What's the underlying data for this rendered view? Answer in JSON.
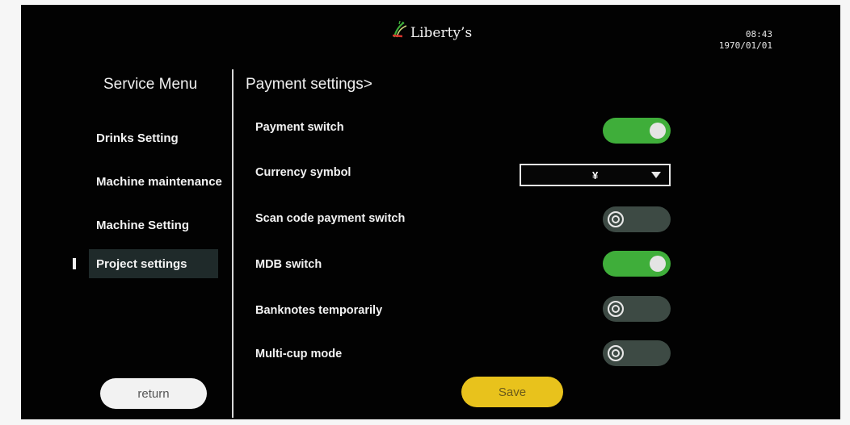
{
  "header": {
    "brand": "Liberty’s",
    "time": "08:43",
    "date": "1970/01/01"
  },
  "sidebar": {
    "title": "Service Menu",
    "items": [
      {
        "label": "Drinks Setting"
      },
      {
        "label": "Machine maintenance"
      },
      {
        "label": "Machine Setting"
      },
      {
        "label": "Project settings"
      }
    ],
    "active_index": 3,
    "return_label": "return"
  },
  "main": {
    "breadcrumb": "Payment settings>",
    "settings": [
      {
        "label": "Payment switch",
        "type": "toggle",
        "on": true
      },
      {
        "label": "Currency symbol",
        "type": "select",
        "value": "¥"
      },
      {
        "label": "Scan code payment switch",
        "type": "toggle",
        "on": false
      },
      {
        "label": "MDB switch",
        "type": "toggle",
        "on": true
      },
      {
        "label": "Banknotes temporarily",
        "type": "toggle",
        "on": false
      },
      {
        "label": "Multi-cup mode",
        "type": "toggle",
        "on": false
      }
    ],
    "save_label": "Save"
  },
  "colors": {
    "background": "#020202",
    "toggle_on": "#3fae3a",
    "toggle_off": "#3d4a44",
    "save_button": "#e8c21c",
    "active_menu": "#1f2a2a"
  },
  "icons": [
    "liberty-logo-icon",
    "chevron-down-icon",
    "toggle-knob-icon"
  ]
}
